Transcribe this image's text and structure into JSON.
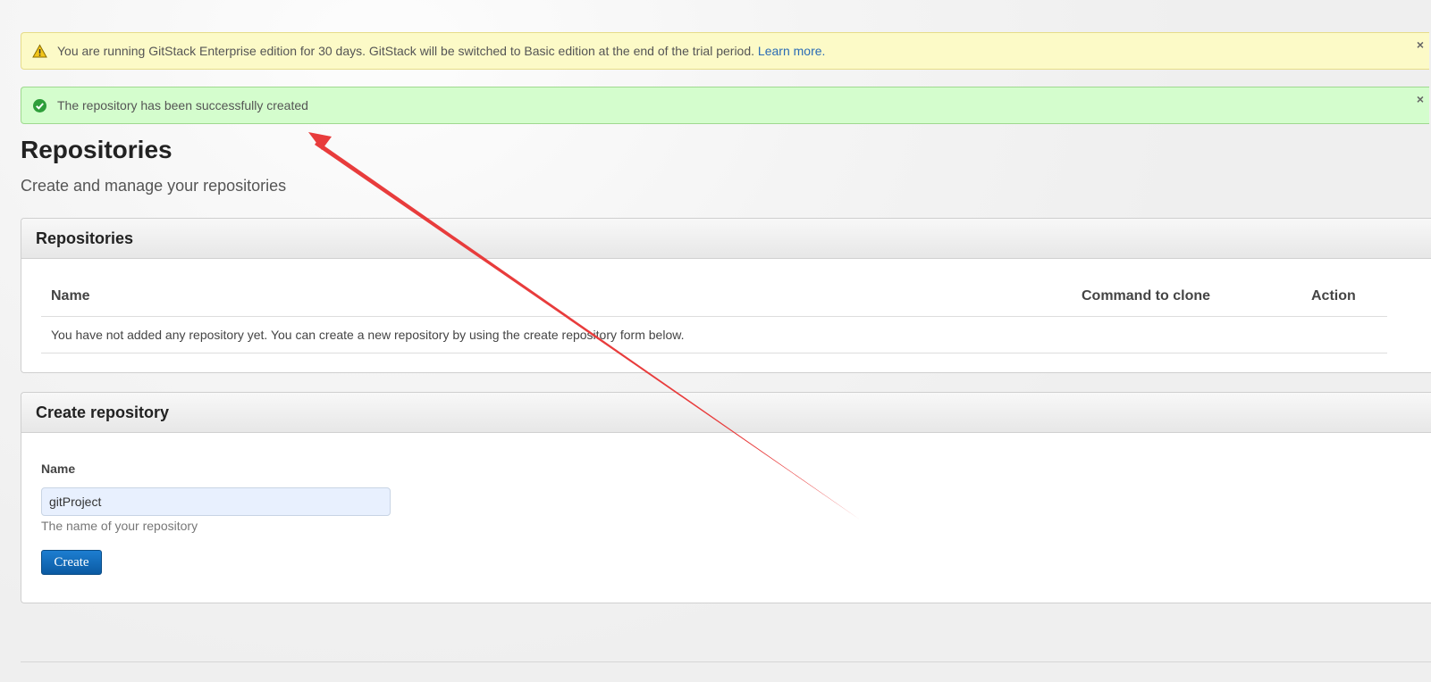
{
  "alerts": {
    "warning": {
      "text": "You are running GitStack Enterprise edition for 30 days. GitStack will be switched to Basic edition at the end of the trial period.",
      "link": "Learn more.",
      "close": "×"
    },
    "success": {
      "text": "The repository has been successfully created",
      "close": "×"
    }
  },
  "page": {
    "title": "Repositories",
    "subtitle": "Create and manage your repositories"
  },
  "repositories_panel": {
    "title": "Repositories",
    "columns": {
      "name": "Name",
      "clone": "Command to clone",
      "action": "Action"
    },
    "empty_message": "You have not added any repository yet. You can create a new repository by using the create repository form below."
  },
  "create_panel": {
    "title": "Create repository",
    "name_label": "Name",
    "name_value": "gitProject",
    "help": "The name of your repository",
    "button": "Create"
  },
  "colors": {
    "warning_bg": "#fcfac7",
    "success_bg": "#d4fdcd",
    "primary_button": "#1d7ed1",
    "annotation_arrow": "#e83c3c"
  },
  "icons": {
    "warning": "warning-triangle-icon",
    "success": "check-circle-icon"
  }
}
